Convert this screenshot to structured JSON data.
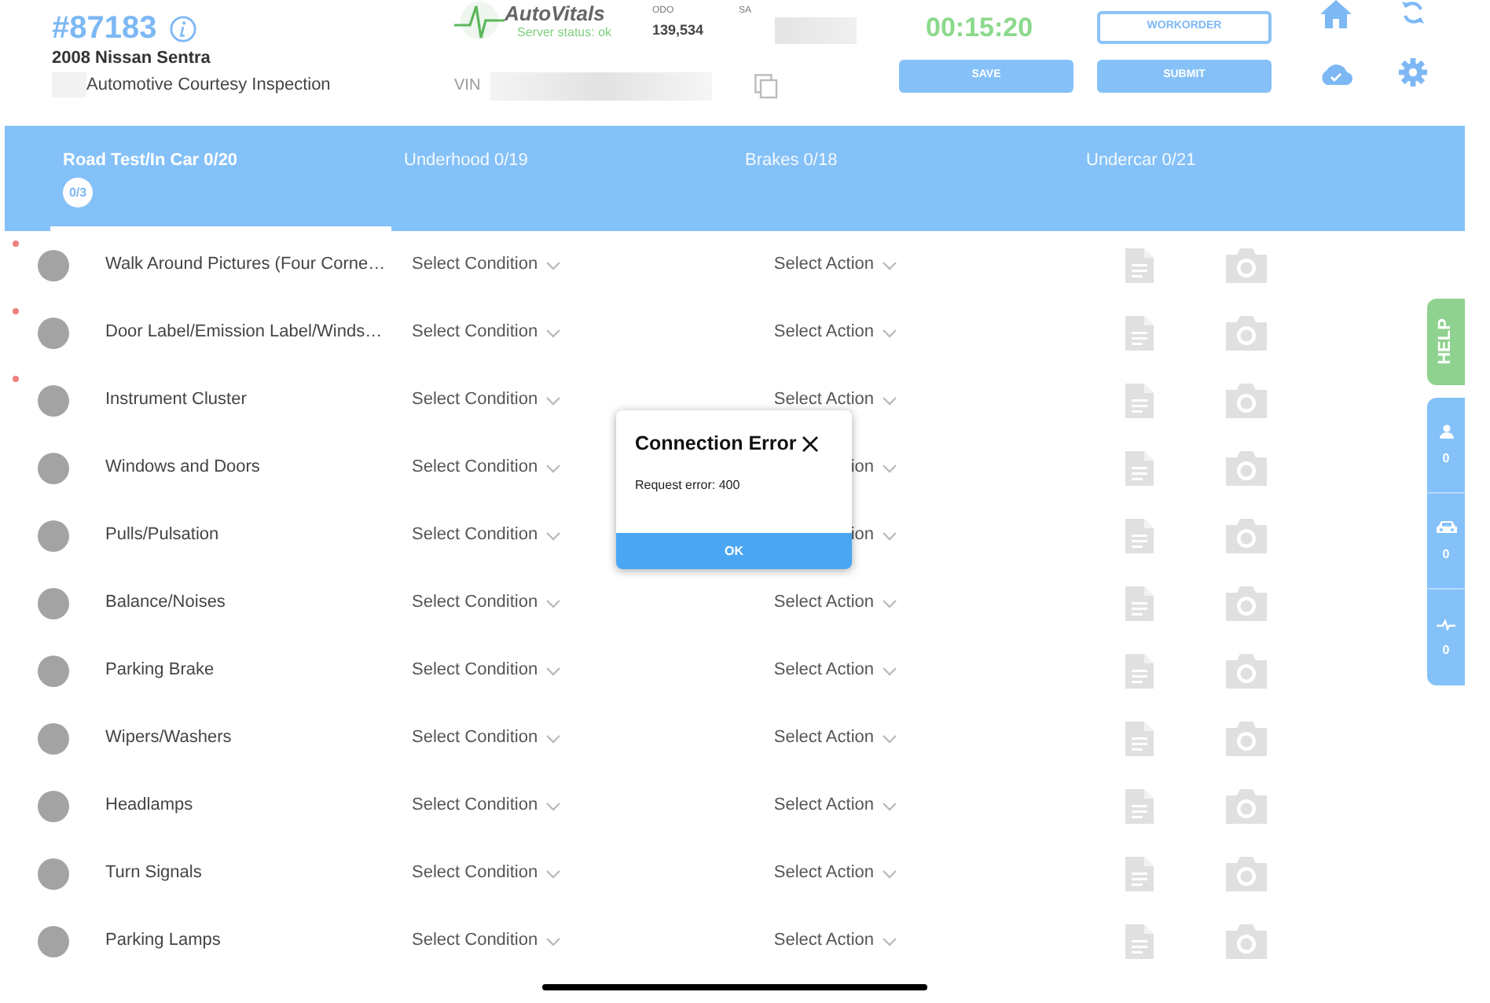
{
  "header": {
    "order_number": "#87183",
    "vehicle": "2008 Nissan Sentra",
    "inspection": "Automotive Courtesy Inspection",
    "logo_text": "AutoVitals",
    "server_status": "Server status: ok",
    "odo_label": "ODO",
    "odo_value": "139,534",
    "sa_label": "SA",
    "vin_label": "VIN",
    "timer": "00:15:20",
    "buttons": [
      {
        "label": "WORKORDER",
        "kind": "outline"
      },
      {
        "label": "SAVE",
        "kind": "filled"
      },
      {
        "label": "SUBMIT",
        "kind": "filled"
      }
    ]
  },
  "tabs": [
    {
      "label": "Road Test/In Car 0/20",
      "selected": true,
      "badge": "0/3"
    },
    {
      "label": "Underhood 0/19",
      "selected": false
    },
    {
      "label": "Brakes 0/18",
      "selected": false
    },
    {
      "label": "Undercar 0/21",
      "selected": false
    }
  ],
  "rows": [
    {
      "label": "Walk Around Pictures (Four Corne…",
      "condition": "Select Condition",
      "action": "Select Action",
      "flagged": true
    },
    {
      "label": "Door Label/Emission Label/Winds…",
      "condition": "Select Condition",
      "action": "Select Action",
      "flagged": true
    },
    {
      "label": "Instrument Cluster",
      "condition": "Select Condition",
      "action": "Select Action",
      "flagged": true
    },
    {
      "label": "Windows and Doors",
      "condition": "Select Condition",
      "action": "ion",
      "flagged": false
    },
    {
      "label": "Pulls/Pulsation",
      "condition": "Select Condition",
      "action": "ion",
      "flagged": false
    },
    {
      "label": "Balance/Noises",
      "condition": "Select Condition",
      "action": "Select Action",
      "flagged": false
    },
    {
      "label": "Parking Brake",
      "condition": "Select Condition",
      "action": "Select Action",
      "flagged": false
    },
    {
      "label": "Wipers/Washers",
      "condition": "Select Condition",
      "action": "Select Action",
      "flagged": false
    },
    {
      "label": "Headlamps",
      "condition": "Select Condition",
      "action": "Select Action",
      "flagged": false
    },
    {
      "label": "Turn Signals",
      "condition": "Select Condition",
      "action": "Select Action",
      "flagged": false
    },
    {
      "label": "Parking Lamps",
      "condition": "Select Condition",
      "action": "Select Action",
      "flagged": false
    }
  ],
  "side_panel": {
    "help": "HELP",
    "counters": [
      {
        "kind": "person",
        "count": "0"
      },
      {
        "kind": "car",
        "count": "0"
      },
      {
        "kind": "pulse",
        "count": "0"
      }
    ]
  },
  "dialog": {
    "title": "Connection Error",
    "message": "Request error: 400",
    "button": "OK"
  }
}
